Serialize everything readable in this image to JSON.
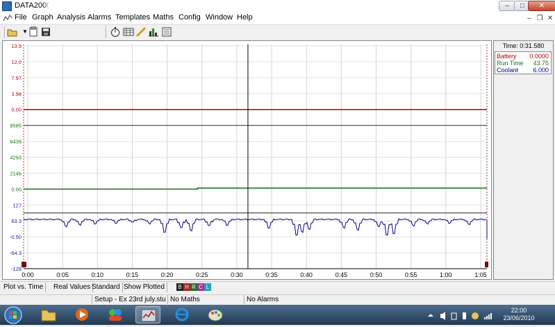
{
  "window": {
    "title": "DATA2000 -"
  },
  "menu": [
    "File",
    "Graph",
    "Analysis",
    "Alarms",
    "Templates",
    "Maths",
    "Config",
    "Window",
    "Help"
  ],
  "chart_data": {
    "type": "line",
    "x_tick_labels": [
      "0:00",
      "0:05",
      "0:10",
      "0:15",
      "0:20",
      "0:25",
      "0:30",
      "0:35",
      "0:40",
      "0:45",
      "0:50",
      "0:55",
      "1:00",
      "1:05"
    ],
    "y_tick_labels": [
      {
        "text": "13.9",
        "color": "#a01010"
      },
      {
        "text": "12.0",
        "color": "#a01010"
      },
      {
        "text": "7.97",
        "color": "#a01010"
      },
      {
        "text": "3.98",
        "color": "#a01010"
      },
      {
        "text": "0.00",
        "color": "#a01010"
      },
      {
        "text": "8585",
        "color": "#1a6b1a"
      },
      {
        "text": "6439",
        "color": "#1a6b1a"
      },
      {
        "text": "4293",
        "color": "#1a6b1a"
      },
      {
        "text": "2146",
        "color": "#1a6b1a"
      },
      {
        "text": "0.00",
        "color": "#1a6b1a"
      },
      {
        "text": "127",
        "color": "#1a1a8a"
      },
      {
        "text": "63.3",
        "color": "#1a1a8a"
      },
      {
        "text": "-0.50",
        "color": "#1a1a8a"
      },
      {
        "text": "-64.3",
        "color": "#1a1a8a"
      },
      {
        "text": "-128",
        "color": "#1a1a8a"
      }
    ],
    "cursor_time": "0:31.580",
    "series": [
      {
        "name": "Battery",
        "value": "0.0000",
        "color": "#b00000"
      },
      {
        "name": "Run Time",
        "value": "43.75",
        "color": "#207020"
      },
      {
        "name": "Coolant",
        "value": "6.000",
        "color": "#000080"
      }
    ],
    "coolant_dips": [
      {
        "t": 0.09,
        "d": 10
      },
      {
        "t": 0.12,
        "d": 8
      },
      {
        "t": 0.155,
        "d": 6
      },
      {
        "t": 0.2,
        "d": 5
      },
      {
        "t": 0.235,
        "d": 4
      },
      {
        "t": 0.27,
        "d": 6
      },
      {
        "t": 0.305,
        "d": 18
      },
      {
        "t": 0.34,
        "d": 12
      },
      {
        "t": 0.36,
        "d": 16
      },
      {
        "t": 0.4,
        "d": 9
      },
      {
        "t": 0.44,
        "d": 8
      },
      {
        "t": 0.53,
        "d": 12
      },
      {
        "t": 0.59,
        "d": 22
      },
      {
        "t": 0.6,
        "d": 18
      },
      {
        "t": 0.615,
        "d": 14
      },
      {
        "t": 0.69,
        "d": 12
      },
      {
        "t": 0.72,
        "d": 15
      },
      {
        "t": 0.765,
        "d": 10
      },
      {
        "t": 0.785,
        "d": 22
      },
      {
        "t": 0.8,
        "d": 20
      },
      {
        "t": 0.84,
        "d": 9
      },
      {
        "t": 0.87,
        "d": 6
      },
      {
        "t": 0.92,
        "d": 5
      },
      {
        "t": 0.96,
        "d": 7
      }
    ]
  },
  "side_panel": {
    "time_label": "Time: 0:31.580"
  },
  "statusbar": [
    "Plot vs. Time",
    "Real Values",
    "Standard",
    "Show Plotted"
  ],
  "legend_badges": [
    "B",
    "H",
    "R",
    "C",
    "L"
  ],
  "bottombar": [
    "Setup - Ex 23rd july.stu",
    "No Maths",
    "No Alarms"
  ],
  "tray": {
    "time": "22:00",
    "date": "23/06/2010"
  }
}
